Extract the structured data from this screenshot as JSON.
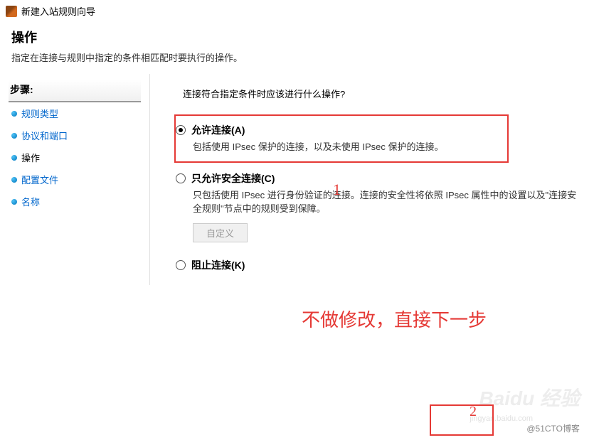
{
  "window": {
    "title": "新建入站规则向导"
  },
  "header": {
    "title": "操作",
    "description": "指定在连接与规则中指定的条件相匹配时要执行的操作。"
  },
  "sidebar": {
    "header": "步骤:",
    "items": [
      {
        "label": "规则类型",
        "current": false
      },
      {
        "label": "协议和端口",
        "current": false
      },
      {
        "label": "操作",
        "current": true
      },
      {
        "label": "配置文件",
        "current": false
      },
      {
        "label": "名称",
        "current": false
      }
    ]
  },
  "content": {
    "question": "连接符合指定条件时应该进行什么操作?",
    "options": [
      {
        "label": "允许连接(A)",
        "description": "包括使用 IPsec 保护的连接，以及未使用 IPsec 保护的连接。",
        "checked": true,
        "highlighted": true
      },
      {
        "label": "只允许安全连接(C)",
        "description": "只包括使用 IPsec 进行身份验证的连接。连接的安全性将依照 IPsec 属性中的设置以及\"连接安全规则\"节点中的规则受到保障。",
        "checked": false,
        "customButton": "自定义"
      },
      {
        "label": "阻止连接(K)",
        "description": "",
        "checked": false
      }
    ]
  },
  "annotations": {
    "num1": "1",
    "num2": "2",
    "text": "不做修改，直接下一步"
  },
  "watermark": {
    "main": "Baidu 经验",
    "sub": "jingyan.baidu.com",
    "footer": "@51CTO博客"
  }
}
